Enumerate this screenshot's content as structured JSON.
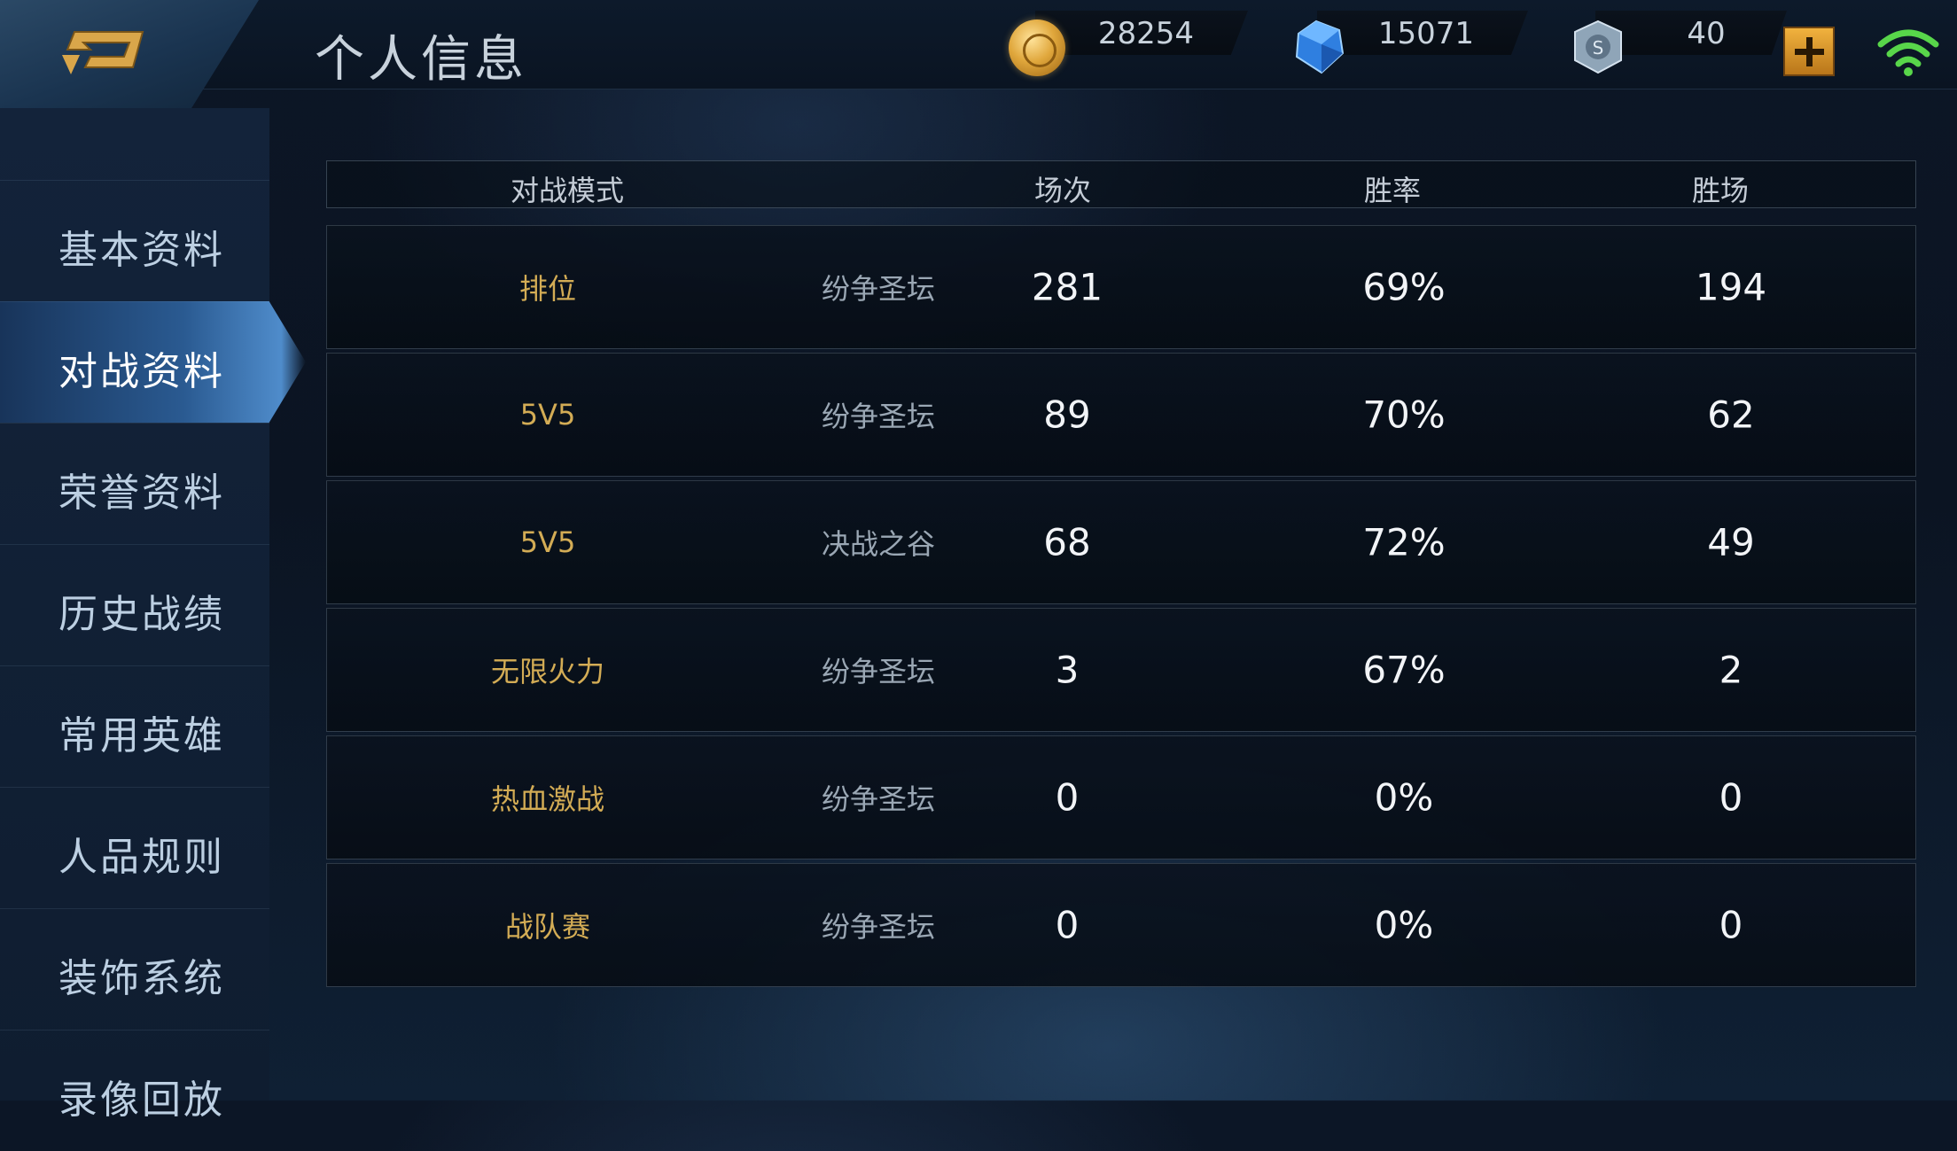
{
  "header": {
    "title": "个人信息",
    "coins": "28254",
    "diamonds": "15071",
    "tokens": "40"
  },
  "sidebar": {
    "items": [
      {
        "label": "基本资料",
        "active": false
      },
      {
        "label": "对战资料",
        "active": true
      },
      {
        "label": "荣誉资料",
        "active": false
      },
      {
        "label": "历史战绩",
        "active": false
      },
      {
        "label": "常用英雄",
        "active": false
      },
      {
        "label": "人品规则",
        "active": false
      },
      {
        "label": "装饰系统",
        "active": false
      },
      {
        "label": "录像回放",
        "active": false
      }
    ]
  },
  "table": {
    "headers": {
      "mode": "对战模式",
      "matches": "场次",
      "win_rate": "胜率",
      "wins": "胜场"
    },
    "rows": [
      {
        "mode": "排位",
        "map": "纷争圣坛",
        "matches": "281",
        "win_rate": "69%",
        "wins": "194"
      },
      {
        "mode": "5V5",
        "map": "纷争圣坛",
        "matches": "89",
        "win_rate": "70%",
        "wins": "62"
      },
      {
        "mode": "5V5",
        "map": "决战之谷",
        "matches": "68",
        "win_rate": "72%",
        "wins": "49"
      },
      {
        "mode": "无限火力",
        "map": "纷争圣坛",
        "matches": "3",
        "win_rate": "67%",
        "wins": "2"
      },
      {
        "mode": "热血激战",
        "map": "纷争圣坛",
        "matches": "0",
        "win_rate": "0%",
        "wins": "0"
      },
      {
        "mode": "战队赛",
        "map": "纷争圣坛",
        "matches": "0",
        "win_rate": "0%",
        "wins": "0"
      }
    ]
  },
  "colors": {
    "accent_gold": "#d3ac55",
    "active_tab": "#2a5a91"
  }
}
